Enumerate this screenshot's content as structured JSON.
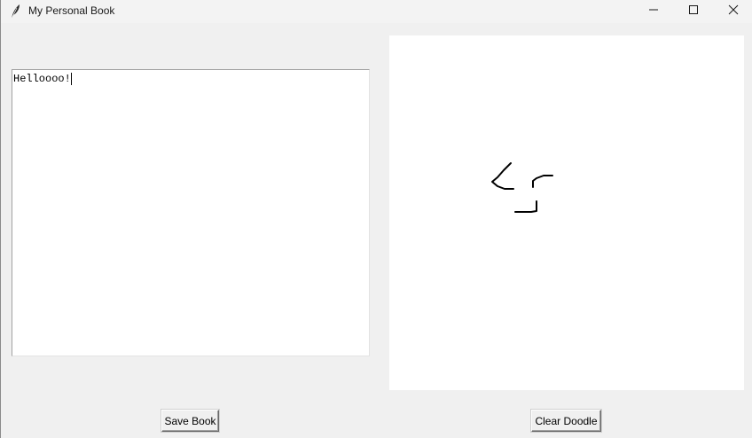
{
  "window": {
    "title": "My Personal Book",
    "icon": "feather-icon"
  },
  "controls": {
    "minimize_icon": "minimize-icon",
    "maximize_icon": "maximize-icon",
    "close_icon": "close-icon"
  },
  "editor": {
    "content": "Helloooo!"
  },
  "buttons": {
    "save_label": "Save Book",
    "clear_label": "Clear Doodle"
  },
  "colors": {
    "window_bg": "#f0f0f0",
    "canvas_bg": "#ffffff",
    "ink": "#000000"
  }
}
